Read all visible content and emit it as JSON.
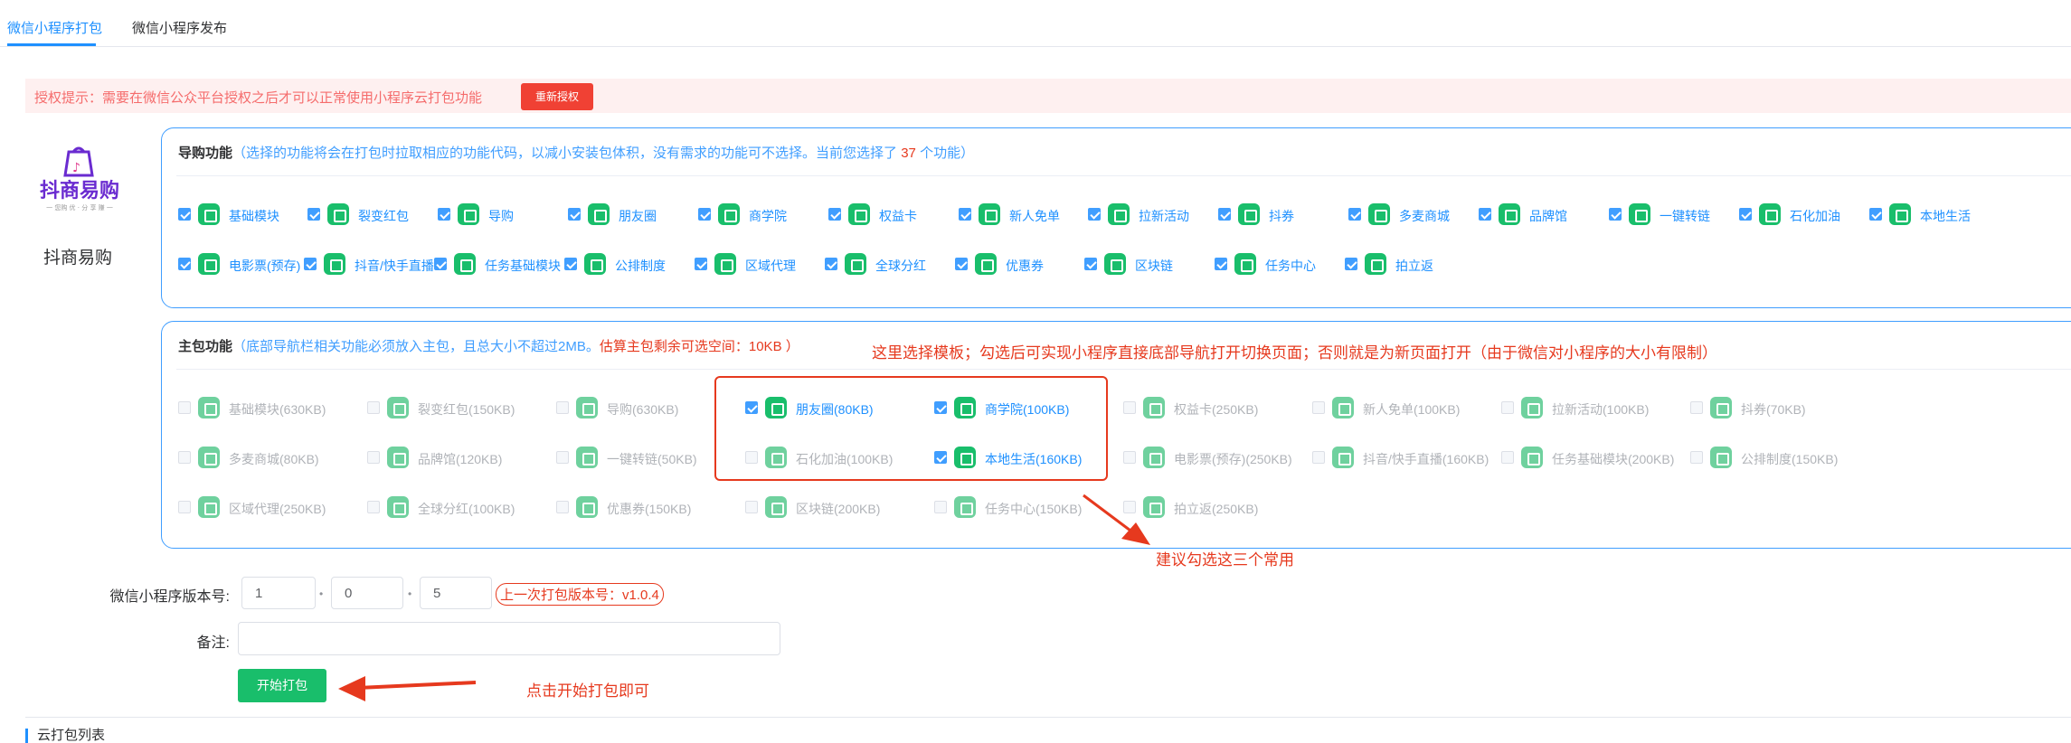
{
  "tabs": [
    {
      "label": "微信小程序打包",
      "active": true
    },
    {
      "label": "微信小程序发布",
      "active": false
    }
  ],
  "auth": {
    "text": "授权提示：需要在微信公众平台授权之后才可以正常使用小程序云打包功能",
    "button": "重新授权"
  },
  "app": {
    "logo_text": "抖商易购",
    "logo_sub": "一 您购 优 · 分 享 赚 一",
    "name": "抖商易购"
  },
  "guide": {
    "title": "导购功能",
    "desc": "（选择的功能将会在打包时拉取相应的功能代码，以减小安装包体积，没有需求的功能可不选择。当前您选择了",
    "count": "37",
    "desc_end": "个功能）",
    "items": [
      {
        "label": "基础模块",
        "checked": true,
        "icon": "package-icon"
      },
      {
        "label": "裂变红包",
        "checked": true,
        "icon": "red-packet-icon"
      },
      {
        "label": "导购",
        "checked": true,
        "icon": "shopping-bag-icon"
      },
      {
        "label": "朋友圈",
        "checked": true,
        "icon": "moments-icon"
      },
      {
        "label": "商学院",
        "checked": true,
        "icon": "graduation-cap-icon"
      },
      {
        "label": "权益卡",
        "checked": true,
        "icon": "card-icon"
      },
      {
        "label": "新人免单",
        "checked": true,
        "icon": "gift-icon"
      },
      {
        "label": "拉新活动",
        "checked": true,
        "icon": "trophy-icon"
      },
      {
        "label": "抖券",
        "checked": true,
        "icon": "tiktok-icon"
      },
      {
        "label": "多麦商城",
        "checked": true,
        "icon": "mall-icon"
      },
      {
        "label": "品牌馆",
        "checked": true,
        "icon": "brand-icon"
      },
      {
        "label": "一键转链",
        "checked": true,
        "icon": "link-icon"
      },
      {
        "label": "石化加油",
        "checked": true,
        "icon": "fuel-icon"
      },
      {
        "label": "本地生活",
        "checked": true,
        "icon": "crown-icon"
      },
      {
        "label": "电影票(预存)",
        "checked": true,
        "icon": "film-icon"
      },
      {
        "label": "抖音/快手直播",
        "checked": true,
        "icon": "live-icon"
      },
      {
        "label": "任务基础模块",
        "checked": true,
        "icon": "task-icon"
      },
      {
        "label": "公排制度",
        "checked": true,
        "icon": "bag-icon"
      },
      {
        "label": "区域代理",
        "checked": true,
        "icon": "region-icon"
      },
      {
        "label": "全球分红",
        "checked": true,
        "icon": "globe-icon"
      },
      {
        "label": "优惠券",
        "checked": true,
        "icon": "coupon-icon"
      },
      {
        "label": "区块链",
        "checked": true,
        "icon": "coin-icon"
      },
      {
        "label": "任务中心",
        "checked": true,
        "icon": "task-center-icon"
      },
      {
        "label": "拍立返",
        "checked": true,
        "icon": "rebate-icon"
      }
    ]
  },
  "main_pkg": {
    "title": "主包功能",
    "desc": "（底部导航栏相关功能必须放入主包，且总大小不超过2MB。",
    "remain": "估算主包剩余可选空间：10KB ）",
    "items": [
      {
        "label": "基础模块(630KB)",
        "checked": false
      },
      {
        "label": "裂变红包(150KB)",
        "checked": false
      },
      {
        "label": "导购(630KB)",
        "checked": false
      },
      {
        "label": "朋友圈(80KB)",
        "checked": true
      },
      {
        "label": "商学院(100KB)",
        "checked": true
      },
      {
        "label": "权益卡(250KB)",
        "checked": false
      },
      {
        "label": "新人免单(100KB)",
        "checked": false
      },
      {
        "label": "拉新活动(100KB)",
        "checked": false
      },
      {
        "label": "抖券(70KB)",
        "checked": false
      },
      {
        "label": "多麦商城(80KB)",
        "checked": false
      },
      {
        "label": "品牌馆(120KB)",
        "checked": false
      },
      {
        "label": "一键转链(50KB)",
        "checked": false
      },
      {
        "label": "石化加油(100KB)",
        "checked": false
      },
      {
        "label": "本地生活(160KB)",
        "checked": true
      },
      {
        "label": "电影票(预存)(250KB)",
        "checked": false
      },
      {
        "label": "抖音/快手直播(160KB)",
        "checked": false
      },
      {
        "label": "任务基础模块(200KB)",
        "checked": false
      },
      {
        "label": "公排制度(150KB)",
        "checked": false
      },
      {
        "label": "区域代理(250KB)",
        "checked": false
      },
      {
        "label": "全球分红(100KB)",
        "checked": false
      },
      {
        "label": "优惠券(150KB)",
        "checked": false
      },
      {
        "label": "区块链(200KB)",
        "checked": false
      },
      {
        "label": "任务中心(150KB)",
        "checked": false
      },
      {
        "label": "拍立返(250KB)",
        "checked": false
      }
    ]
  },
  "annotations": {
    "template_note": "这里选择模板；勾选后可实现小程序直接底部导航打开切换页面；否则就是为新页面打开（由于微信对小程序的大小有限制）",
    "suggest_note": "建议勾选这三个常用",
    "start_note": "点击开始打包即可"
  },
  "form": {
    "version_label": "微信小程序版本号:",
    "version": [
      "1",
      "0",
      "5"
    ],
    "last_version": "上一次打包版本号：v1.0.4",
    "remark_label": "备注:",
    "remark_value": "",
    "start_button": "开始打包"
  },
  "cloud_list_title": "云打包列表"
}
